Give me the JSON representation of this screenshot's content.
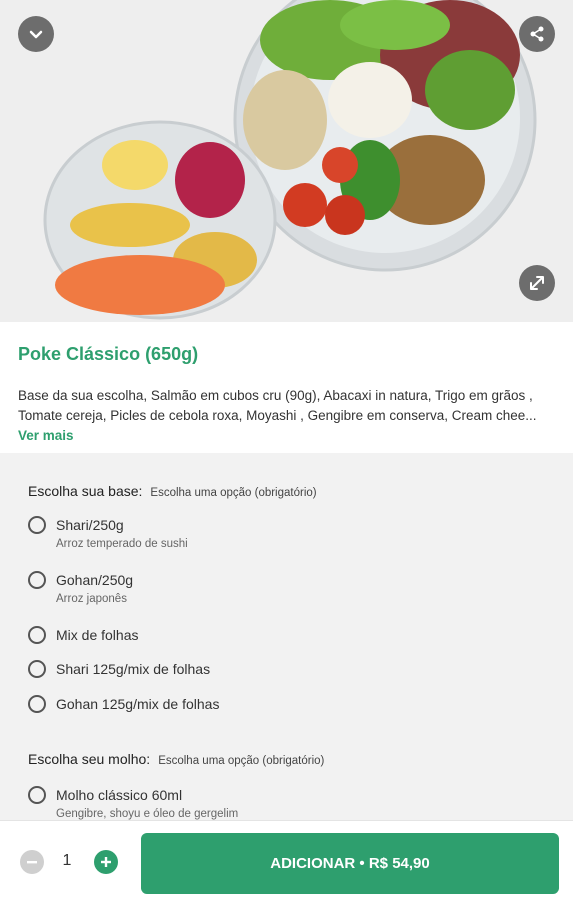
{
  "header": {
    "back_icon": "chevron-down-icon",
    "share_icon": "share-icon",
    "expand_icon": "expand-icon"
  },
  "product": {
    "title": "Poke Clássico (650g)",
    "description": "Base da sua escolha, Salmão em cubos cru (90g), Abacaxi in natura, Trigo em grãos , Tomate cereja, Picles de cebola roxa, Moyashi , Gengibre em conserva, Cream chee...",
    "see_more": "Ver mais"
  },
  "groups": [
    {
      "title": "Escolha sua base:",
      "subtitle": "Escolha uma opção (obrigatório)",
      "options": [
        {
          "label": "Shari/250g",
          "sub": "Arroz temperado de sushi"
        },
        {
          "label": "Gohan/250g",
          "sub": "Arroz japonês"
        },
        {
          "label": "Mix de folhas"
        },
        {
          "label": "Shari 125g/mix de folhas"
        },
        {
          "label": "Gohan 125g/mix de folhas"
        }
      ]
    },
    {
      "title": "Escolha seu molho:",
      "subtitle": "Escolha uma opção (obrigatório)",
      "options": [
        {
          "label": "Molho clássico 60ml",
          "sub": "Gengibre, shoyu e óleo de gergelim"
        }
      ]
    }
  ],
  "footer": {
    "quantity": "1",
    "add_button": "ADICIONAR • R$ 54,90"
  },
  "colors": {
    "accent": "#2e9f6e",
    "options_bg": "#f2f2f2"
  }
}
